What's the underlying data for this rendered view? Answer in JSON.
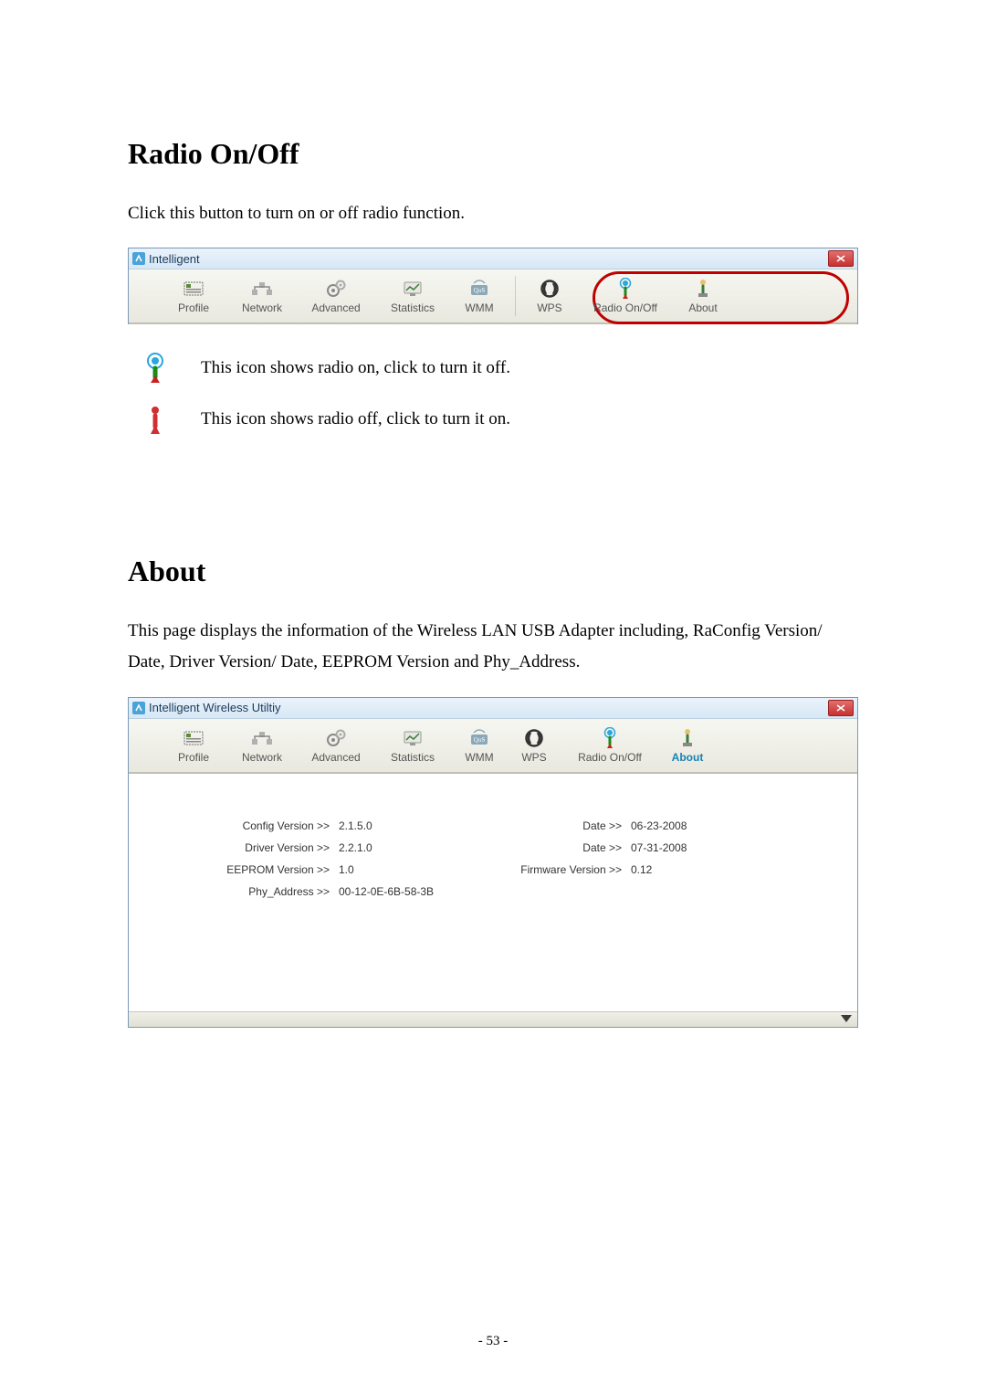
{
  "sections": {
    "radio": {
      "heading": "Radio On/Off",
      "intro": "Click this button to turn on or off radio function.",
      "window_title": "Intelligent",
      "legend_on": "This icon shows radio on, click to turn it off.",
      "legend_off": "This icon shows radio off, click to turn it on."
    },
    "about": {
      "heading": "About",
      "intro": "This page displays the information of the Wireless LAN USB Adapter including, RaConfig Version/ Date, Driver Version/ Date, EEPROM Version and Phy_Address.",
      "window_title": "Intelligent Wireless Utiltiy",
      "rows": [
        {
          "l1": "Config Version >>",
          "v1": "2.1.5.0",
          "l2": "Date >>",
          "v2": "06-23-2008"
        },
        {
          "l1": "Driver Version >>",
          "v1": "2.2.1.0",
          "l2": "Date >>",
          "v2": "07-31-2008"
        },
        {
          "l1": "EEPROM Version >>",
          "v1": "1.0",
          "l2": "Firmware Version >>",
          "v2": "0.12"
        },
        {
          "l1": "Phy_Address >>",
          "v1": "00-12-0E-6B-58-3B",
          "l2": "",
          "v2": ""
        }
      ]
    }
  },
  "toolbar": {
    "items": [
      {
        "key": "profile",
        "label": "Profile"
      },
      {
        "key": "network",
        "label": "Network"
      },
      {
        "key": "advanced",
        "label": "Advanced"
      },
      {
        "key": "statistics",
        "label": "Statistics"
      },
      {
        "key": "wmm",
        "label": "WMM"
      },
      {
        "key": "wps",
        "label": "WPS"
      },
      {
        "key": "radio",
        "label": "Radio On/Off"
      },
      {
        "key": "about",
        "label": "About"
      }
    ]
  },
  "toolbar_widths": {
    "profile": 72,
    "network": 78,
    "advanced": 84,
    "statistics": 84,
    "wmm": 62,
    "wps": 58,
    "radio": 108,
    "about": 62
  },
  "colors": {
    "heading": "#000000",
    "accent": "#1683b5",
    "red_ring": "#c00000"
  },
  "page_number": "- 53 -"
}
